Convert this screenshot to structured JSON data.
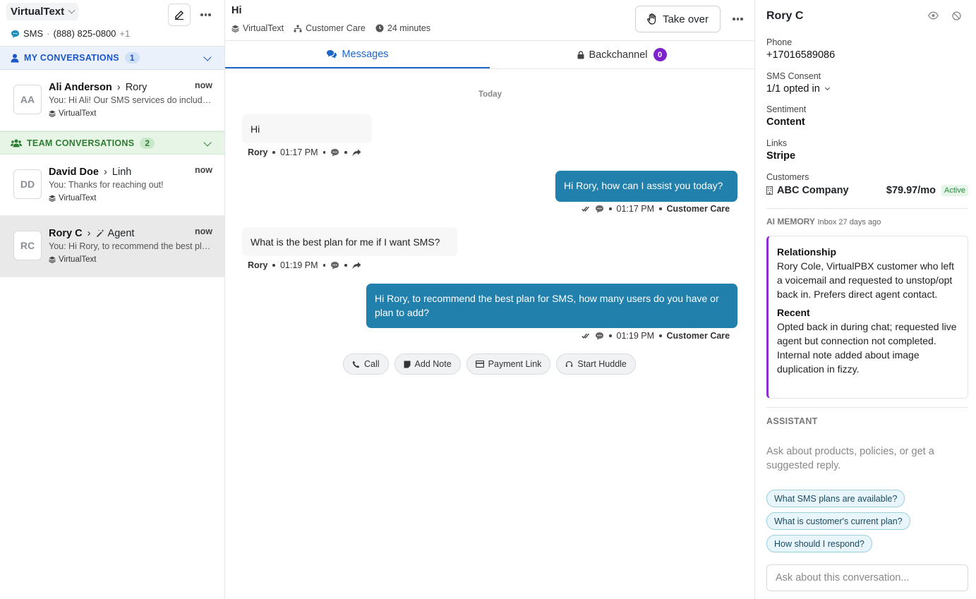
{
  "sidebar": {
    "workspace": "VirtualText",
    "channel_label": "SMS",
    "phone": "(888) 825-0800",
    "phone_extra": "+1",
    "my_section": {
      "label": "MY CONVERSATIONS",
      "count": "1"
    },
    "team_section": {
      "label": "TEAM CONVERSATIONS",
      "count": "2"
    },
    "conversations": [
      {
        "initials": "AA",
        "name": "Ali Anderson",
        "assignee": "Rory",
        "time": "now",
        "preview": "You: Hi Ali! Our SMS services do include...",
        "inbox": "VirtualText"
      },
      {
        "initials": "DD",
        "name": "David Doe",
        "assignee": "Linh",
        "time": "now",
        "preview": "You: Thanks for reaching out!",
        "inbox": "VirtualText"
      },
      {
        "initials": "RC",
        "name": "Rory C",
        "assignee": "Agent",
        "time": "now",
        "preview": "You: Hi Rory, to recommend the best plan...",
        "inbox": "VirtualText"
      }
    ]
  },
  "conversation": {
    "title": "Hi",
    "inbox": "VirtualText",
    "team": "Customer Care",
    "duration": "24 minutes",
    "take_over_label": "Take over",
    "tabs": {
      "messages": "Messages",
      "backchannel": "Backchannel",
      "backchannel_count": "0"
    },
    "date_divider": "Today",
    "messages": [
      {
        "text": "Hi",
        "sender": "Rory",
        "time": "01:17 PM"
      },
      {
        "text": "Hi Rory, how can I assist you today?",
        "sender": "Customer Care",
        "time": "01:17 PM"
      },
      {
        "text": "What is the best plan for me if I want SMS?",
        "sender": "Rory",
        "time": "01:19 PM"
      },
      {
        "text": "Hi Rory, to recommend the best plan for SMS, how many users do you have or plan to add?",
        "sender": "Customer Care",
        "time": "01:19 PM"
      }
    ],
    "actions": {
      "call": "Call",
      "note": "Add Note",
      "payment": "Payment Link",
      "huddle": "Start Huddle"
    }
  },
  "contact": {
    "name": "Rory C",
    "phone_label": "Phone",
    "phone": "+17016589086",
    "consent_label": "SMS Consent",
    "consent": "1/1 opted in",
    "sentiment_label": "Sentiment",
    "sentiment": "Content",
    "links_label": "Links",
    "links": "Stripe",
    "customers_label": "Customers",
    "customer_name": "ABC Company",
    "customer_price": "$79.97/mo",
    "customer_status": "Active",
    "ai_memory_label": "AI MEMORY",
    "ai_memory_meta": "Inbox 27 days ago",
    "relationship_title": "Relationship",
    "relationship_text": "Rory Cole, VirtualPBX customer who left a voicemail and requested to unstop/opt back in. Prefers direct agent contact.",
    "recent_title": "Recent",
    "recent_text": "Opted back in during chat; requested live agent but connection not completed. Internal note added about image duplication in fizzy.",
    "assistant_label": "ASSISTANT",
    "assistant_hint": "Ask about products, policies, or get a suggested reply.",
    "suggestions": [
      "What SMS plans are available?",
      "What is customer's current plan?",
      "How should I respond?"
    ],
    "ask_placeholder": "Ask about this conversation..."
  },
  "colors": {
    "accent": "#1e66c8",
    "outbound_bubble": "#2180ac",
    "backchannel_badge": "#7e22ce",
    "ai_memory_border": "#8b2fd6"
  }
}
